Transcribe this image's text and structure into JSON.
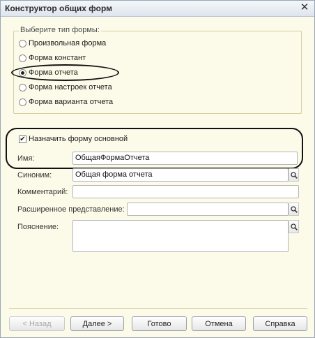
{
  "window": {
    "title": "Конструктор общих форм",
    "close_label": "✕"
  },
  "form_type_group": {
    "legend": "Выберите тип формы:",
    "options": [
      {
        "label": "Произвольная форма",
        "checked": false
      },
      {
        "label": "Форма констант",
        "checked": false
      },
      {
        "label": "Форма отчета",
        "checked": true
      },
      {
        "label": "Форма настроек отчета",
        "checked": false
      },
      {
        "label": "Форма варианта отчета",
        "checked": false
      }
    ]
  },
  "main_form_checkbox": {
    "label": "Назначить форму основной",
    "checked": true
  },
  "fields": {
    "name": {
      "label": "Имя:",
      "value": "ОбщаяФормаОтчета"
    },
    "synonym": {
      "label": "Синоним:",
      "value": "Общая форма отчета"
    },
    "comment": {
      "label": "Комментарий:",
      "value": ""
    },
    "extended_view": {
      "label": "Расширенное представление:",
      "value": ""
    },
    "explanation": {
      "label": "Пояснение:",
      "value": ""
    }
  },
  "buttons": {
    "back": "< Назад",
    "next": "Далее >",
    "done": "Готово",
    "cancel": "Отмена",
    "help": "Справка"
  },
  "colors": {
    "dialog_bg": "#fcfae8",
    "title_bg": "#dfe5ee",
    "accent_border": "#d6cfa0"
  }
}
